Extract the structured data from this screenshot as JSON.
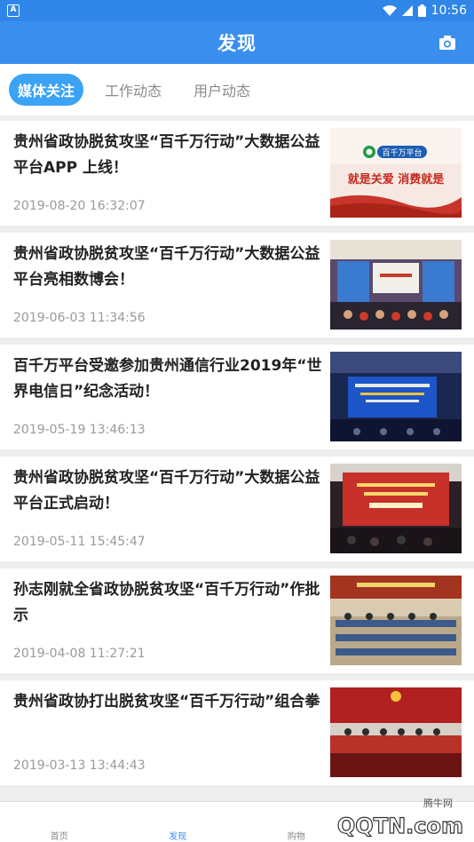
{
  "status_bar": {
    "left_icon_letter": "A",
    "time": "10:56"
  },
  "header": {
    "title": "发现",
    "camera_icon": "camera-icon"
  },
  "tabs": [
    {
      "label": "媒体关注",
      "active": true
    },
    {
      "label": "工作动态",
      "active": false
    },
    {
      "label": "用户动态",
      "active": false
    }
  ],
  "articles": [
    {
      "title": "贵州省政协脱贫攻坚“百千万行动”大数据公益平台APP 上线！",
      "date": "2019-08-20 16:32:07",
      "thumb_logo": "百千万平台",
      "thumb_text": "就是关爱 消费就是"
    },
    {
      "title": "贵州省政协脱贫攻坚“百千万行动”大数据公益平台亮相数博会！",
      "date": "2019-06-03 11:34:56"
    },
    {
      "title": "百千万平台受邀参加贵州通信行业2019年“世界电信日”纪念活动！",
      "date": "2019-05-19 13:46:13"
    },
    {
      "title": "贵州省政协脱贫攻坚“百千万行动”大数据公益平台正式启动！",
      "date": "2019-05-11 15:45:47"
    },
    {
      "title": "孙志刚就全省政协脱贫攻坚“百千万行动”作批示",
      "date": "2019-04-08 11:27:21"
    },
    {
      "title": "贵州省政协打出脱贫攻坚“百千万行动”组合拳",
      "date": "2019-03-13 13:44:43"
    }
  ],
  "tabbar": [
    {
      "label": "首页",
      "active": false
    },
    {
      "label": "发现",
      "active": true
    },
    {
      "label": "购物",
      "active": false
    },
    {
      "label": "",
      "active": false
    }
  ],
  "watermark": {
    "site": "腾牛网",
    "logo_text": "QQTN.com"
  }
}
